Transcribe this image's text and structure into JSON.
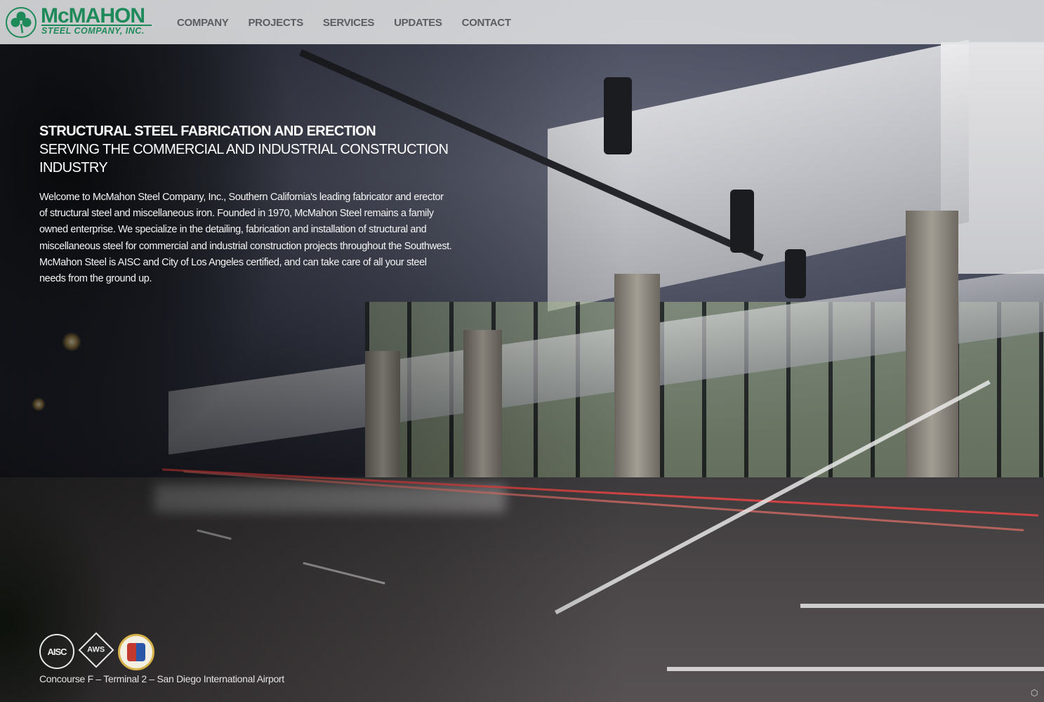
{
  "logo": {
    "main": "McMAHON",
    "sub": "STEEL COMPANY, INC.",
    "color": "#1e8a5a"
  },
  "nav": [
    {
      "label": "COMPANY"
    },
    {
      "label": "PROJECTS"
    },
    {
      "label": "SERVICES"
    },
    {
      "label": "UPDATES"
    },
    {
      "label": "CONTACT"
    }
  ],
  "hero": {
    "title": "STRUCTURAL STEEL FABRICATION AND ERECTION",
    "subtitle": "SERVING THE COMMERCIAL AND INDUSTRIAL CONSTRUCTION INDUSTRY",
    "body": "Welcome to McMahon Steel Company, Inc., Southern California's leading fabricator and erector of structural steel and miscellaneous iron.  Founded in 1970, McMahon Steel remains a family owned enterprise. We specialize in the detailing, fabrication and installation of structural and miscellaneous steel for commercial and industrial construction projects throughout the Southwest.  McMahon Steel is AISC and City of Los Angeles certified, and can take care of all your steel needs from the ground up."
  },
  "badges": {
    "aisc": "AISC",
    "aws": "AWS"
  },
  "caption": "Concourse F – Terminal 2 – San Diego International Airport"
}
